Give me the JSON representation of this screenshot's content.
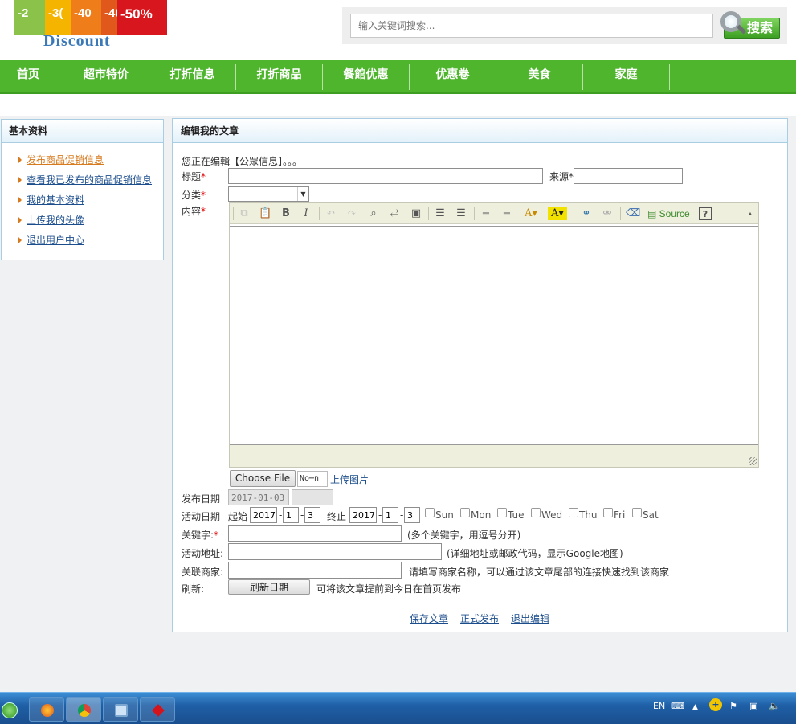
{
  "logo": {
    "tags": [
      "-2",
      "-3(",
      "-40",
      "-50%"
    ],
    "word": "Discount"
  },
  "search": {
    "placeholder": "输入关键词搜索...",
    "button": "搜索"
  },
  "nav": [
    "首页",
    "超市特价",
    "打折信息",
    "打折商品",
    "餐館优惠",
    "优惠卷",
    "美食",
    "家庭"
  ],
  "sidebar": {
    "title": "基本资料",
    "items": [
      "发布商品促销信息",
      "查看我已发布的商品促销信息",
      "我的基本资料",
      "上传我的头像",
      "退出用户中心"
    ]
  },
  "main": {
    "title": "编辑我的文章",
    "notice": "您正在编輯【公眾信息】。。。",
    "label_title": "标题",
    "label_source": "来源",
    "label_category": "分类",
    "label_content": "内容",
    "toolbar_source": "Source",
    "toolbar_help": "?",
    "choose_file": "Choose File",
    "no_file": "No⋯n",
    "upload_image": "上传图片",
    "label_pub_date": "发布日期",
    "pub_date": "2017-01-03",
    "label_activity_date": "活动日期",
    "start_label": "起始",
    "end_label": "终止",
    "start": {
      "year": "2017",
      "month": "1",
      "day": "3"
    },
    "end": {
      "year": "2017",
      "month": "1",
      "day": "3"
    },
    "weekdays": [
      "Sun",
      "Mon",
      "Tue",
      "Wed",
      "Thu",
      "Fri",
      "Sat"
    ],
    "label_keywords": "关键字:",
    "keywords_hint": "(多个关键字，用逗号分开)",
    "label_address": "活动地址:",
    "address_hint": "(详细地址或邮政代码，显示Google地图)",
    "label_merchant": "关联商家:",
    "merchant_hint": "请填写商家名称，可以通过该文章尾部的连接快速找到该商家",
    "label_refresh": "刷新:",
    "refresh_button": "刷新日期",
    "refresh_hint": "可将该文章提前到今日在首页发布",
    "actions": [
      "保存文章",
      "正式发布",
      "退出编辑"
    ]
  },
  "taskbar": {
    "lang": "EN"
  }
}
